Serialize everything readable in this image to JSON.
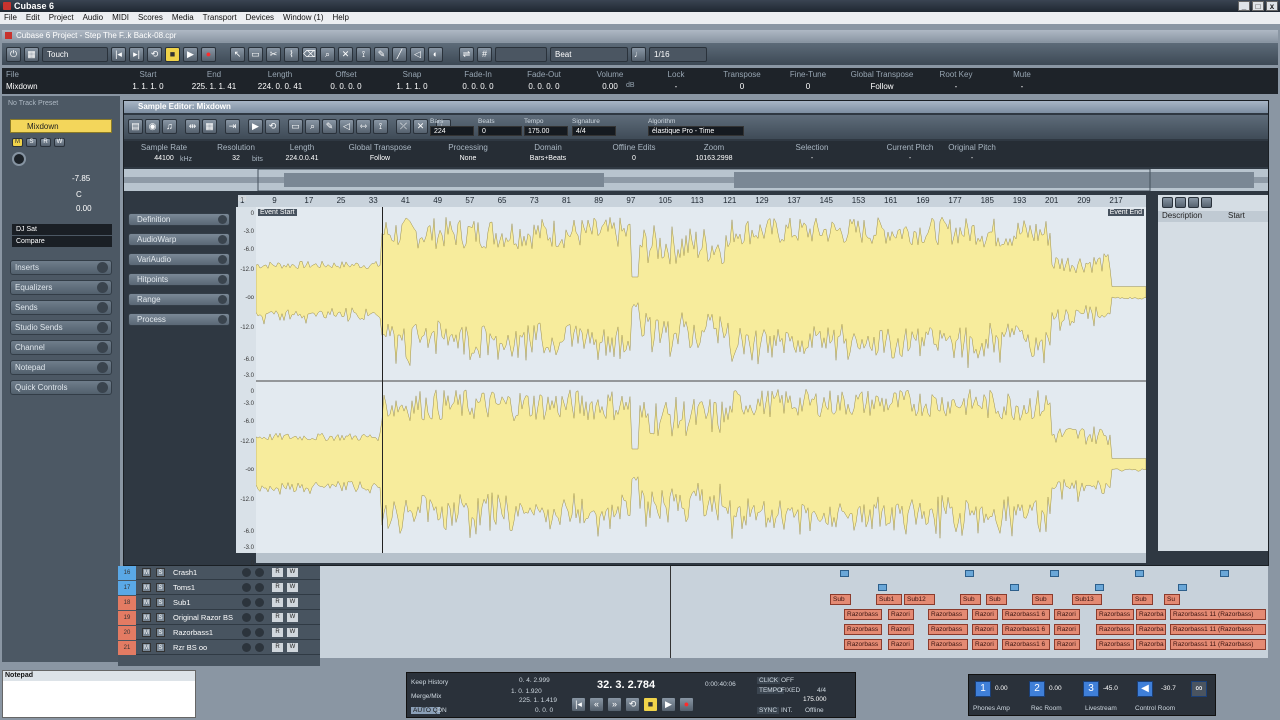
{
  "app": {
    "title": "Cubase 6",
    "win_min": "_",
    "win_max": "□",
    "win_close": "x"
  },
  "menu": [
    "File",
    "Edit",
    "Project",
    "Audio",
    "MIDI",
    "Scores",
    "Media",
    "Transport",
    "Devices",
    "Window (1)",
    "Help"
  ],
  "project": {
    "title": "Cubase 6 Project - Step The F..k Back-08.cpr",
    "toolbar": {
      "automation": "Touch",
      "quantize_mode": "Beat",
      "quantize_value": "1/16"
    }
  },
  "infoline": {
    "file_label": "File",
    "file_value": "Mixdown",
    "columns": [
      {
        "h": "Start",
        "v": "1. 1. 1. 0"
      },
      {
        "h": "End",
        "v": "225. 1. 1. 41"
      },
      {
        "h": "Length",
        "v": "224. 0. 0. 41"
      },
      {
        "h": "Offset",
        "v": "0. 0. 0. 0"
      },
      {
        "h": "Snap",
        "v": "1. 1. 1. 0"
      },
      {
        "h": "Fade-In",
        "v": "0. 0. 0. 0"
      },
      {
        "h": "Fade-Out",
        "v": "0. 0. 0. 0"
      },
      {
        "h": "Volume",
        "v": "0.00"
      },
      {
        "h": "Lock",
        "v": "-"
      },
      {
        "h": "Transpose",
        "v": "0"
      },
      {
        "h": "Fine-Tune",
        "v": "0"
      },
      {
        "h": "Global Transpose",
        "v": "Follow"
      },
      {
        "h": "Root Key",
        "v": "-"
      },
      {
        "h": "Mute",
        "v": "-"
      }
    ],
    "volume_unit": "dB"
  },
  "inspector": {
    "preset": "No Track Preset",
    "track_name": "Mixdown",
    "volume": "-7.85",
    "pan": "C",
    "delay": "0.00",
    "dj_sat": "DJ Sat",
    "compare": "Compare",
    "sections": [
      "Inserts",
      "Equalizers",
      "Sends",
      "Studio Sends",
      "Channel",
      "Notepad",
      "Quick Controls"
    ]
  },
  "sample_editor": {
    "title": "Sample Editor: Mixdown",
    "fields": [
      {
        "h": "Bars",
        "v": "224"
      },
      {
        "h": "Beats",
        "v": "0"
      },
      {
        "h": "Tempo",
        "v": "175.00"
      },
      {
        "h": "Signature",
        "v": "4/4"
      },
      {
        "h": "Algorithm",
        "v": "élastique Pro - Time"
      }
    ],
    "info": [
      {
        "h": "Sample Rate",
        "v": "44100"
      },
      {
        "h": "Resolution",
        "v": "32"
      },
      {
        "h": "Length",
        "v": "224.0.0.41"
      },
      {
        "h": "Global Transpose",
        "v": "Follow"
      },
      {
        "h": "Processing",
        "v": "None"
      },
      {
        "h": "Domain",
        "v": "Bars+Beats"
      },
      {
        "h": "Offline Edits",
        "v": "0"
      },
      {
        "h": "Zoom",
        "v": "10163.2998"
      },
      {
        "h": "Selection",
        "v": "-"
      },
      {
        "h": "Current Pitch",
        "v": "-"
      },
      {
        "h": "Original Pitch",
        "v": "-"
      }
    ],
    "sample_rate_unit": "kHz",
    "resolution_unit": "bits",
    "ruler_db": "dB",
    "ruler": [
      "1",
      "9",
      "17",
      "25",
      "33",
      "41",
      "49",
      "57",
      "65",
      "73",
      "81",
      "89",
      "97",
      "105",
      "113",
      "121",
      "129",
      "137",
      "145",
      "153",
      "161",
      "169",
      "177",
      "185",
      "193",
      "201",
      "209",
      "217"
    ],
    "event_start": "Event Start",
    "event_end": "Event End",
    "db_scale": [
      "0",
      "-3.0",
      "-6.0",
      "-12.0",
      "-oo",
      "-12.0",
      "-6.0",
      "-3.0",
      "0"
    ],
    "panels": [
      "Definition",
      "AudioWarp",
      "VariAudio",
      "Hitpoints",
      "Range",
      "Process"
    ],
    "right_columns": {
      "description": "Description",
      "start": "Start"
    }
  },
  "tracks": [
    {
      "num": "16",
      "name": "Crash1",
      "color": "#5aa8e6"
    },
    {
      "num": "17",
      "name": "Toms1",
      "color": "#5aa8e6"
    },
    {
      "num": "18",
      "name": "Sub1",
      "color": "#e37b63"
    },
    {
      "num": "19",
      "name": "Original Razor BS",
      "color": "#e37b63"
    },
    {
      "num": "20",
      "name": "Razorbass1",
      "color": "#e37b63"
    },
    {
      "num": "21",
      "name": "Rzr BS oo",
      "color": "#e37b63"
    }
  ],
  "track_buttons": {
    "mute": "M",
    "solo": "S",
    "read": "R",
    "write": "W"
  },
  "clips": {
    "sub": [
      "Sub",
      "Sub1",
      "Sub12",
      "Sub",
      "Sub",
      "Sub",
      "Sub13",
      "Sub",
      "Su"
    ],
    "razor": [
      "Razorbass",
      "Razori",
      "Razorbass",
      "Razori",
      "Razorbass1 6",
      "Razori",
      "Razorbass",
      "Razorba",
      "Razorbass1 11 (Razorbass)"
    ]
  },
  "notepad": {
    "title": "Notepad"
  },
  "transport": {
    "keep_history": "Keep History",
    "merge_mix": "Merge/Mix",
    "auto_q": "AUTO Q",
    "auto_q_state": "ON",
    "left_locator": "0. 4. 2.999",
    "left_locator2": "1. 0. 1.920",
    "right_locator": "225. 1. 1.419",
    "right_locator2": "0. 0. 0",
    "position": "32. 3. 2.784",
    "time": "0:00:40:06",
    "click": "CLICK",
    "click_state": "OFF",
    "tempo": "TEMPO",
    "tempo_mode": "FIXED",
    "signature": "4/4",
    "tempo_value": "175.000",
    "sync": "SYNC",
    "sync_src": "INT.",
    "offline": "Offline"
  },
  "control_room": {
    "labels": [
      "Phones Amp",
      "Rec Room",
      "Livestream",
      "Control Room"
    ],
    "levels": [
      "0.00",
      "0.00",
      "-45.0",
      "-30.7"
    ],
    "buttons": [
      "1",
      "2",
      "3"
    ]
  },
  "colors": {
    "accent_yellow": "#f3d65b",
    "waveform": "#f7ec9c",
    "bg": "#4c5864"
  }
}
